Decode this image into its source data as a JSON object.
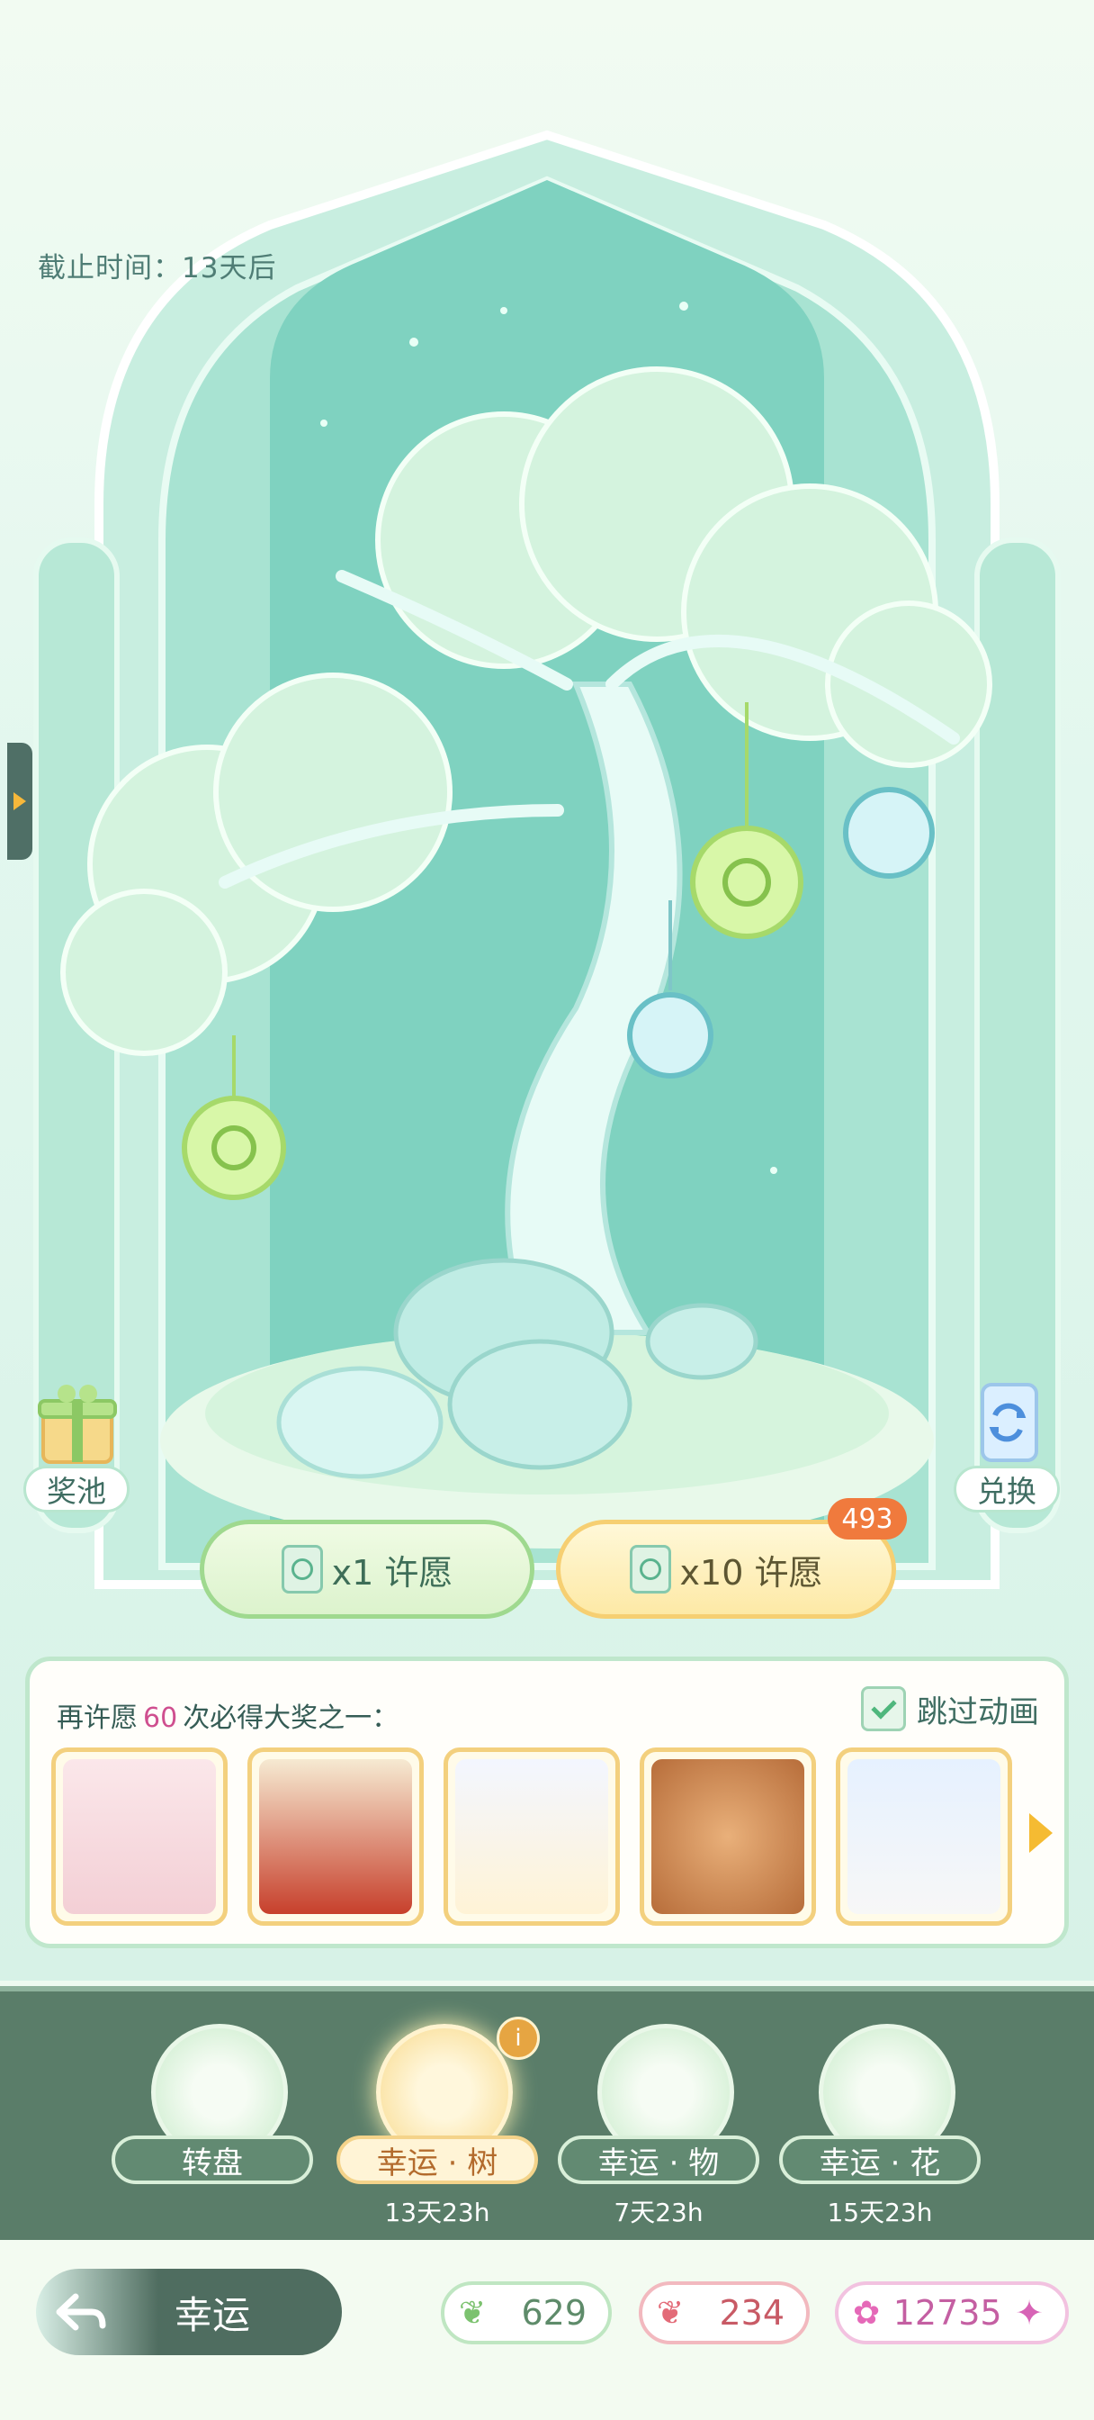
{
  "deadline": "截止时间：13天后",
  "left_buttons": {
    "pool_label": "奖池"
  },
  "right_buttons": {
    "exchange_label": "兑换"
  },
  "wish": {
    "single_label": "x1 许愿",
    "ten_label": "x10 许愿",
    "ten_badge": "493"
  },
  "guarantee": {
    "prefix": "再许愿",
    "count": "60",
    "suffix": "次必得大奖之一：",
    "skip_label": "跳过动画",
    "skip_checked": true,
    "prizes": [
      {
        "name": "bunny-outfit",
        "color": "#f6d9df"
      },
      {
        "name": "red-hanfu-outfit",
        "color": "#c7402c"
      },
      {
        "name": "white-lolita-outfit",
        "color": "#fff3d6"
      },
      {
        "name": "bear-room",
        "color": "#d3905a"
      },
      {
        "name": "piano-gazebo",
        "color": "#dfeffa"
      }
    ]
  },
  "tabs": [
    {
      "label": "转盘",
      "time": "",
      "icon": "compass-icon"
    },
    {
      "label": "幸运 · 树",
      "time": "13天23h",
      "icon": "tree-icon",
      "active": true
    },
    {
      "label": "幸运 · 物",
      "time": "7天23h",
      "icon": "brush-icon"
    },
    {
      "label": "幸运 · 花",
      "time": "15天23h",
      "icon": "flower-icon"
    }
  ],
  "bottom": {
    "title": "幸运",
    "resources": [
      {
        "name": "green-leaf",
        "value": "629"
      },
      {
        "name": "red-feather",
        "value": "234"
      },
      {
        "name": "pink-star",
        "value": "12735"
      }
    ]
  },
  "colors": {
    "accent": "#4fb77d",
    "highlight": "#cf4f8f",
    "tabbar": "#5a7d69"
  }
}
